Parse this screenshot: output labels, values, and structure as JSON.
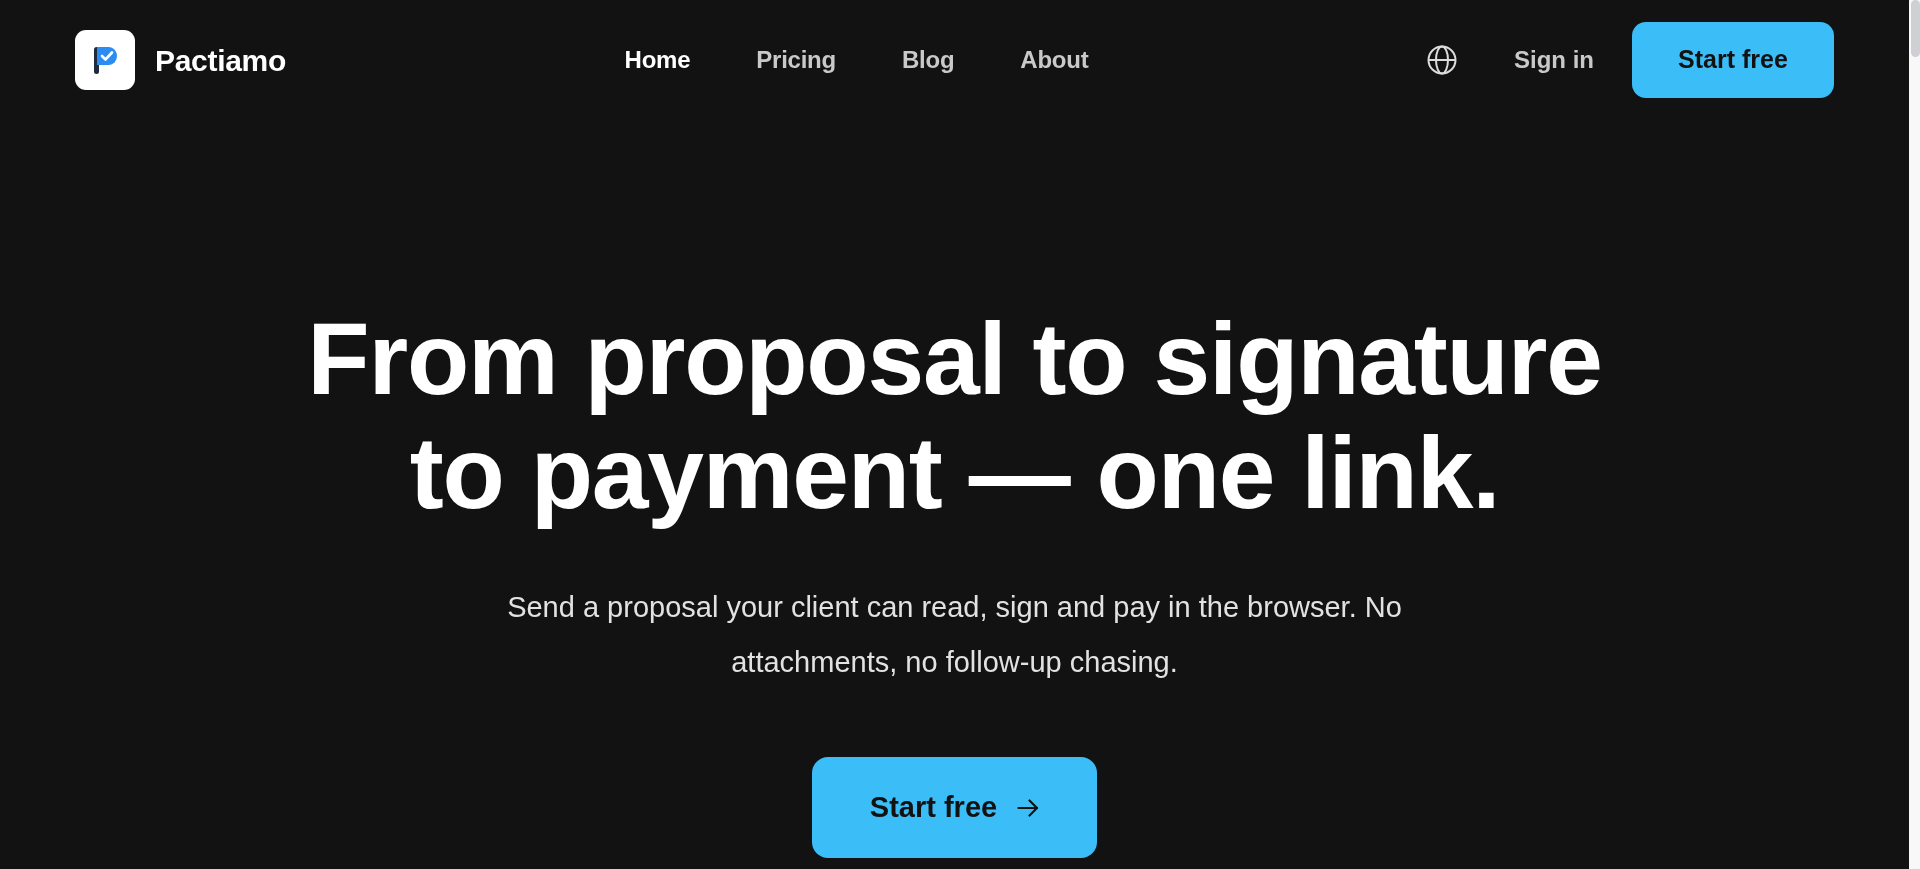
{
  "brand": {
    "name": "Pactiamo"
  },
  "nav": [
    {
      "label": "Home",
      "selected": true
    },
    {
      "label": "Pricing",
      "selected": false
    },
    {
      "label": "Blog",
      "selected": false
    },
    {
      "label": "About",
      "selected": false
    }
  ],
  "actions": {
    "sign_in": "Sign in",
    "start_button": "Start free"
  },
  "hero": {
    "title": "From proposal to signature to payment — one link.",
    "subtitle": "Send a proposal your client can read, sign and pay in the browser. No attachments, no follow-up chasing.",
    "cta": "Start free"
  }
}
